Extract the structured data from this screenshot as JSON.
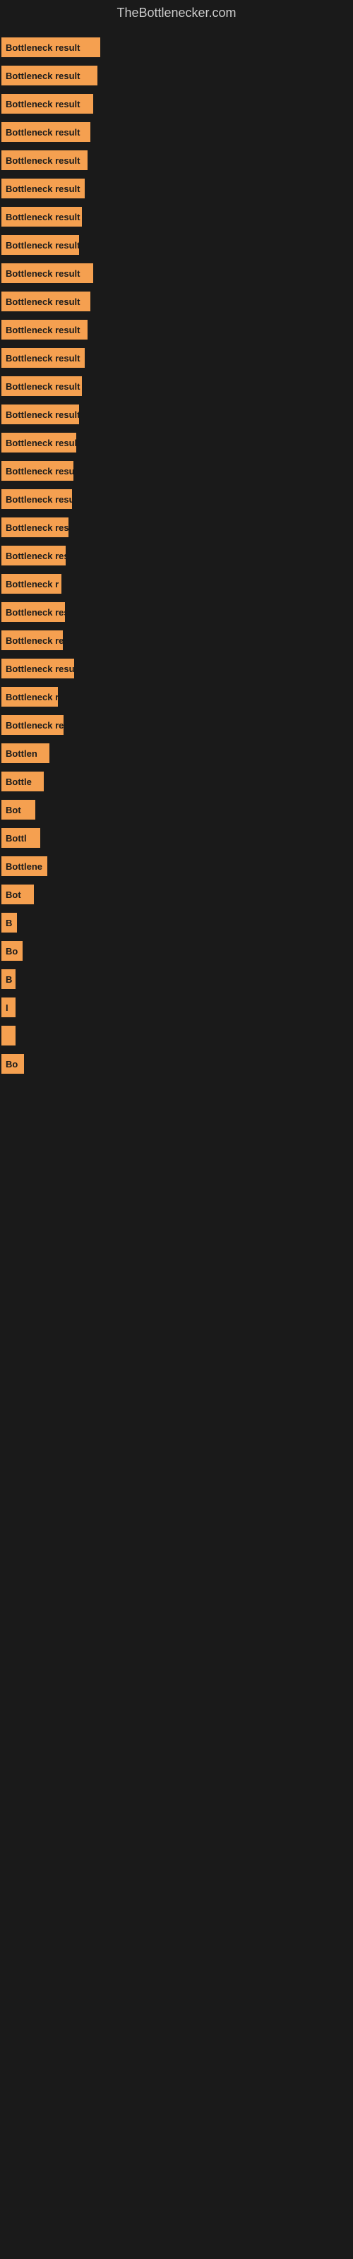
{
  "site": {
    "title": "TheBottlenecker.com"
  },
  "bars": [
    {
      "label": "Bottleneck result",
      "width": 140
    },
    {
      "label": "Bottleneck result",
      "width": 136
    },
    {
      "label": "Bottleneck result",
      "width": 130
    },
    {
      "label": "Bottleneck result",
      "width": 126
    },
    {
      "label": "Bottleneck result",
      "width": 122
    },
    {
      "label": "Bottleneck result",
      "width": 118
    },
    {
      "label": "Bottleneck result",
      "width": 114
    },
    {
      "label": "Bottleneck result",
      "width": 110
    },
    {
      "label": "Bottleneck result",
      "width": 130
    },
    {
      "label": "Bottleneck result",
      "width": 126
    },
    {
      "label": "Bottleneck result",
      "width": 122
    },
    {
      "label": "Bottleneck result",
      "width": 118
    },
    {
      "label": "Bottleneck result",
      "width": 114
    },
    {
      "label": "Bottleneck result",
      "width": 110
    },
    {
      "label": "Bottleneck result",
      "width": 106
    },
    {
      "label": "Bottleneck result",
      "width": 102
    },
    {
      "label": "Bottleneck result",
      "width": 100
    },
    {
      "label": "Bottleneck result",
      "width": 95
    },
    {
      "label": "Bottleneck resu",
      "width": 91
    },
    {
      "label": "Bottleneck r",
      "width": 85
    },
    {
      "label": "Bottleneck resu",
      "width": 90
    },
    {
      "label": "Bottleneck res",
      "width": 87
    },
    {
      "label": "Bottleneck result",
      "width": 103
    },
    {
      "label": "Bottleneck r",
      "width": 80
    },
    {
      "label": "Bottleneck resu",
      "width": 88
    },
    {
      "label": "Bottlen",
      "width": 68
    },
    {
      "label": "Bottle",
      "width": 60
    },
    {
      "label": "Bot",
      "width": 48
    },
    {
      "label": "Bottl",
      "width": 55
    },
    {
      "label": "Bottlene",
      "width": 65
    },
    {
      "label": "Bot",
      "width": 46
    },
    {
      "label": "B",
      "width": 22
    },
    {
      "label": "Bo",
      "width": 30
    },
    {
      "label": "B",
      "width": 20
    },
    {
      "label": "I",
      "width": 14
    },
    {
      "label": "",
      "width": 10
    },
    {
      "label": "Bo",
      "width": 32
    }
  ]
}
